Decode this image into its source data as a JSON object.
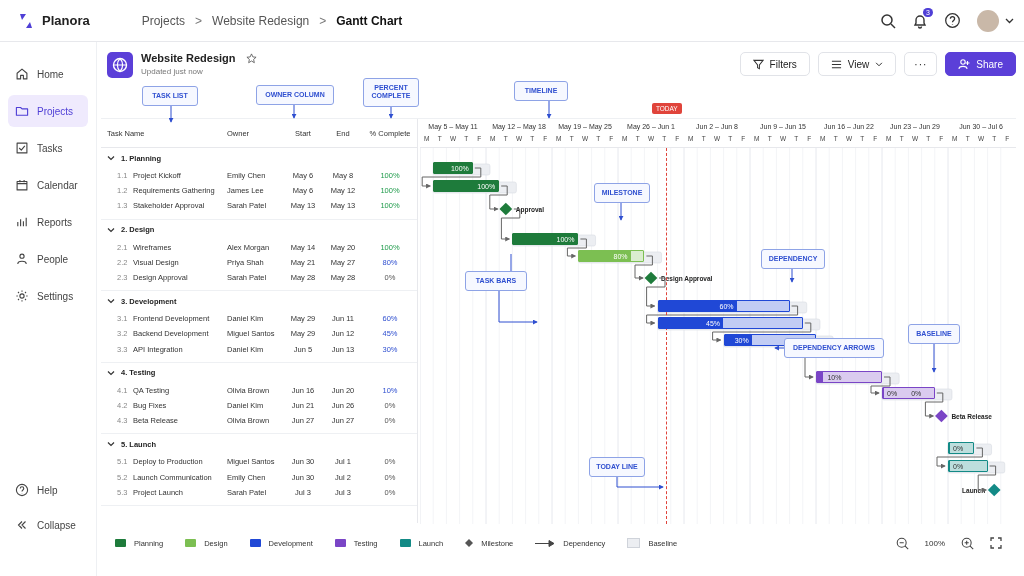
{
  "app": {
    "name": "Planora"
  },
  "breadcrumb": [
    {
      "label": "Projects",
      "current": false
    },
    {
      "label": "Website Redesign",
      "current": false
    },
    {
      "label": "Gantt Chart",
      "current": true
    }
  ],
  "breadcrumb_separator": ">",
  "notifications": {
    "count": "3"
  },
  "sidebar": {
    "items": [
      {
        "label": "Home",
        "selected": false
      },
      {
        "label": "Projects",
        "selected": true
      },
      {
        "label": "Tasks",
        "selected": false
      },
      {
        "label": "Calendar",
        "selected": false
      },
      {
        "label": "Reports",
        "selected": false
      },
      {
        "label": "People",
        "selected": false
      },
      {
        "label": "Settings",
        "selected": false
      }
    ],
    "bottom": [
      {
        "label": "Help"
      },
      {
        "label": "Collapse"
      }
    ]
  },
  "project": {
    "title": "Website Redesign",
    "subtitle": "Updated just now",
    "starred": false
  },
  "toolbar": {
    "filters": "Filters",
    "view": "View",
    "more": "···",
    "share": "Share"
  },
  "table": {
    "columns": [
      "Task Name",
      "Owner",
      "Start",
      "End",
      "% Complete"
    ]
  },
  "groups": [
    {
      "name": "1. Planning",
      "expanded": true,
      "tasks": [
        {
          "num": "1.1",
          "name": "Project Kickoff",
          "owner": "Emily Chen",
          "start": "May 6",
          "end": "May 8",
          "percent": "100%",
          "level": 1,
          "kind": "bar",
          "color": "#1e7b3b",
          "bar_labels": [
            "100%"
          ],
          "linked": false
        },
        {
          "num": "1.2",
          "name": "Requirements Gathering",
          "owner": "James Lee",
          "start": "May 6",
          "end": "May 12",
          "percent": "100%",
          "level": 1,
          "kind": "bar",
          "color": "#1e7b3b",
          "bar_labels": [
            "100%"
          ],
          "linked": true
        },
        {
          "num": "1.3",
          "name": "Stakeholder Approval",
          "owner": "Sarah Patel",
          "start": "May 13",
          "end": "May 13",
          "percent": "100%",
          "done": true,
          "kind": "milestone",
          "color": "#1e7b3b",
          "marker_label": "Approval",
          "linked": true
        }
      ]
    },
    {
      "name": "2. Design",
      "expanded": true,
      "tasks": [
        {
          "num": "2.1",
          "name": "Wireframes",
          "owner": "Alex Morgan",
          "start": "May 14",
          "end": "May 20",
          "percent": "100%",
          "level": 1,
          "kind": "bar",
          "color": "#1e7b3b",
          "bar_labels": [
            "100%"
          ],
          "linked": true
        },
        {
          "num": "2.2",
          "name": "Visual Design",
          "owner": "Priya Shah",
          "start": "May 21",
          "end": "May 27",
          "percent": "80%",
          "level": 0.8,
          "kind": "bar",
          "color": "#7cbf52",
          "bar_labels": [
            "80%"
          ],
          "linked": true
        },
        {
          "num": "2.3",
          "name": "Design Approval",
          "owner": "Sarah Patel",
          "start": "May 28",
          "end": "May 28",
          "percent": "0%",
          "done": false,
          "kind": "milestone",
          "color": "#1e7b3b",
          "marker_label": "Design Approval",
          "linked": true
        }
      ]
    },
    {
      "name": "3. Development",
      "expanded": true,
      "tasks": [
        {
          "num": "3.1",
          "name": "Frontend Development",
          "owner": "Daniel Kim",
          "start": "May 29",
          "end": "Jun 11",
          "percent": "60%",
          "level": 0.6,
          "kind": "bar",
          "color": "#2048d6",
          "bar_labels": [
            "60%"
          ],
          "linked": true
        },
        {
          "num": "3.2",
          "name": "Backend Development",
          "owner": "Miguel Santos",
          "start": "May 29",
          "end": "Jun 12",
          "percent": "45%",
          "level": 0.45,
          "kind": "bar",
          "color": "#2048d6",
          "bar_labels": [
            "45%"
          ],
          "linked": true
        },
        {
          "num": "3.3",
          "name": "API Integration",
          "owner": "Daniel Kim",
          "start": "Jun 5",
          "end": "Jun 13",
          "percent": "30%",
          "level": 0.3,
          "kind": "bar",
          "color": "#2048d6",
          "bar_labels": [
            "30%"
          ],
          "linked": true
        }
      ]
    },
    {
      "name": "4. Testing",
      "expanded": true,
      "tasks": [
        {
          "num": "4.1",
          "name": "QA Testing",
          "owner": "Olivia Brown",
          "start": "Jun 16",
          "end": "Jun 20",
          "percent": "10%",
          "level": 0.1,
          "kind": "bar",
          "color": "#7a45c6",
          "bar_labels": [
            "10%"
          ],
          "linked": true
        },
        {
          "num": "4.2",
          "name": "Bug Fixes",
          "owner": "Daniel Kim",
          "start": "Jun 21",
          "end": "Jun 26",
          "percent": "0%",
          "level": 0,
          "kind": "bar",
          "color": "#7a45c6",
          "bar_labels": [
            "0%",
            "0%"
          ],
          "linked": true
        },
        {
          "num": "4.3",
          "name": "Beta Release",
          "owner": "Olivia Brown",
          "start": "Jun 27",
          "end": "Jun 27",
          "percent": "0%",
          "done": false,
          "kind": "milestone",
          "color": "#7a45c6",
          "marker_label": "Beta Release",
          "linked": true
        }
      ]
    },
    {
      "name": "5. Launch",
      "expanded": true,
      "tasks": [
        {
          "num": "5.1",
          "name": "Deploy to Production",
          "owner": "Miguel Santos",
          "start": "Jun 30",
          "end": "Jul 1",
          "percent": "0%",
          "level": 0,
          "kind": "bar",
          "color": "#138a86",
          "bar_labels": [
            "0%"
          ],
          "linked": false
        },
        {
          "num": "5.2",
          "name": "Launch Communication",
          "owner": "Emily Chen",
          "start": "Jun 30",
          "end": "Jul 2",
          "percent": "0%",
          "level": 0,
          "kind": "bar",
          "color": "#138a86",
          "bar_labels": [
            "0%"
          ],
          "linked": true
        },
        {
          "num": "5.3",
          "name": "Project Launch",
          "owner": "Sarah Patel",
          "start": "Jul 3",
          "end": "Jul 3",
          "percent": "0%",
          "done": false,
          "kind": "milestone",
          "color": "#138a86",
          "marker_label": "Launch",
          "linked": true
        }
      ]
    }
  ],
  "timeline": {
    "today": {
      "label": "TODAY",
      "level": 0.414
    },
    "weeks": [
      {
        "label": "May 5 – May 11",
        "days": [
          "M",
          "T",
          "W",
          "T",
          "F"
        ]
      },
      {
        "label": "May 12 – May 18",
        "days": [
          "M",
          "T",
          "W",
          "T",
          "F"
        ]
      },
      {
        "label": "May 19 – May 25",
        "days": [
          "M",
          "T",
          "W",
          "T",
          "F"
        ]
      },
      {
        "label": "May 26 – Jun 1",
        "days": [
          "M",
          "T",
          "W",
          "T",
          "F"
        ]
      },
      {
        "label": "Jun 2 – Jun 8",
        "days": [
          "M",
          "T",
          "W",
          "T",
          "F"
        ]
      },
      {
        "label": "Jun 9 – Jun 15",
        "days": [
          "M",
          "T",
          "W",
          "T",
          "F"
        ]
      },
      {
        "label": "Jun 16 – Jun 22",
        "days": [
          "M",
          "T",
          "W",
          "T",
          "F"
        ]
      },
      {
        "label": "Jun 23 – Jun 29",
        "days": [
          "M",
          "T",
          "W",
          "T",
          "F"
        ]
      },
      {
        "label": "Jun 30 – Jul 6",
        "days": [
          "M",
          "T",
          "W",
          "T",
          "F"
        ]
      }
    ]
  },
  "callouts": [
    "TASK LIST",
    "OWNER COLUMN",
    "PERCENT COMPLETE",
    "TIMELINE",
    "MILESTONE",
    "DEPENDENCY",
    "TASK BARS",
    "DEPENDENCY ARROWS",
    "BASELINE",
    "TODAY LINE"
  ],
  "legend": [
    {
      "kind": "swatch",
      "label": "Planning",
      "color": "#1e7b3b"
    },
    {
      "kind": "swatch",
      "label": "Design",
      "color": "#7cbf52"
    },
    {
      "kind": "swatch",
      "label": "Development",
      "color": "#2048d6"
    },
    {
      "kind": "swatch",
      "label": "Testing",
      "color": "#7a45c6"
    },
    {
      "kind": "swatch",
      "label": "Launch",
      "color": "#138a86"
    },
    {
      "kind": "milestone",
      "label": "Milestone"
    },
    {
      "kind": "dependency",
      "label": "Dependency"
    },
    {
      "kind": "baseline",
      "label": "Baseline"
    }
  ],
  "zoom": {
    "value": "100%"
  }
}
